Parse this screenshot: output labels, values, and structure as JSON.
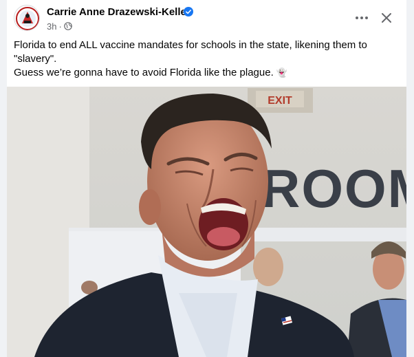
{
  "post": {
    "author_name": "Carrie Anne Drazewski-Keller",
    "time": "3h",
    "separator": "·",
    "audience_icon": "globe-icon",
    "verified_icon": "verified-badge-icon",
    "text_line1": "Florida to end ALL vaccine mandates for schools in the state, likening them to \"slavery\".",
    "text_line2": "Guess we’re gonna have to avoid Florida like the plague.",
    "emoji": "👻",
    "photo_sign_text": "ROOMS",
    "photo_exit_sign": "EXIT"
  },
  "colors": {
    "verified": "#1877f2",
    "secondary_text": "#65676b",
    "primary_text": "#050505",
    "card_bg": "#ffffff",
    "page_bg": "#f0f2f5"
  },
  "icons": {
    "more": "more-options-icon",
    "close": "close-icon"
  }
}
